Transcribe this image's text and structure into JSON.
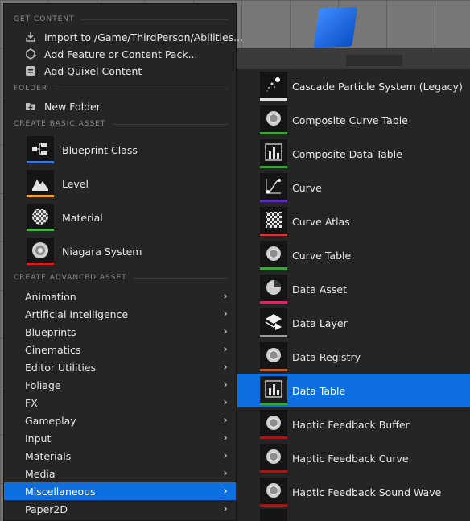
{
  "colors": {
    "selection": "#0e70e0",
    "blueprint": "#3a78d8",
    "level": "#f0a020",
    "material": "#4ab04a",
    "niagara": "#d02020",
    "curve": "#6030c0",
    "curve_atlas": "#c04040",
    "data_asset": "#d02b6a",
    "data_registry": "#c06030",
    "data_layer": "#9a9a9a",
    "green": "#3ea03e",
    "haptic": "#a01818",
    "white": "#e0e0e0"
  },
  "get_content": {
    "header": "GET CONTENT",
    "items": [
      {
        "label": "Import to /Game/ThirdPerson/Abilities...",
        "icon": "import-icon"
      },
      {
        "label": "Add Feature or Content Pack...",
        "icon": "content-pack-icon"
      },
      {
        "label": "Add Quixel Content",
        "icon": "quixel-icon"
      }
    ]
  },
  "folder": {
    "header": "FOLDER",
    "items": [
      {
        "label": "New Folder",
        "icon": "new-folder-icon"
      }
    ]
  },
  "basic_assets": {
    "header": "CREATE BASIC ASSET",
    "items": [
      {
        "label": "Blueprint Class",
        "icon": "blueprint-class-icon"
      },
      {
        "label": "Level",
        "icon": "level-icon"
      },
      {
        "label": "Material",
        "icon": "material-icon"
      },
      {
        "label": "Niagara System",
        "icon": "niagara-system-icon"
      }
    ]
  },
  "advanced_assets": {
    "header": "CREATE ADVANCED ASSET",
    "items": [
      {
        "label": "Animation"
      },
      {
        "label": "Artificial Intelligence"
      },
      {
        "label": "Blueprints"
      },
      {
        "label": "Cinematics"
      },
      {
        "label": "Editor Utilities"
      },
      {
        "label": "Foliage"
      },
      {
        "label": "FX"
      },
      {
        "label": "Gameplay"
      },
      {
        "label": "Input"
      },
      {
        "label": "Materials"
      },
      {
        "label": "Media"
      },
      {
        "label": "Miscellaneous",
        "selected": true
      },
      {
        "label": "Paper2D"
      }
    ]
  },
  "miscellaneous_submenu": {
    "items": [
      {
        "label": "Cascade Particle System (Legacy)",
        "icon": "particle-icon"
      },
      {
        "label": "Composite Curve Table",
        "icon": "composite-curve-table-icon"
      },
      {
        "label": "Composite Data Table",
        "icon": "composite-data-table-icon"
      },
      {
        "label": "Curve",
        "icon": "curve-icon"
      },
      {
        "label": "Curve Atlas",
        "icon": "curve-atlas-icon"
      },
      {
        "label": "Curve Table",
        "icon": "curve-table-icon"
      },
      {
        "label": "Data Asset",
        "icon": "data-asset-icon"
      },
      {
        "label": "Data Layer",
        "icon": "data-layer-icon"
      },
      {
        "label": "Data Registry",
        "icon": "data-registry-icon"
      },
      {
        "label": "Data Table",
        "icon": "data-table-icon",
        "selected": true
      },
      {
        "label": "Haptic Feedback Buffer",
        "icon": "haptic-buffer-icon"
      },
      {
        "label": "Haptic Feedback Curve",
        "icon": "haptic-curve-icon"
      },
      {
        "label": "Haptic Feedback Sound Wave",
        "icon": "haptic-sound-wave-icon"
      }
    ]
  }
}
